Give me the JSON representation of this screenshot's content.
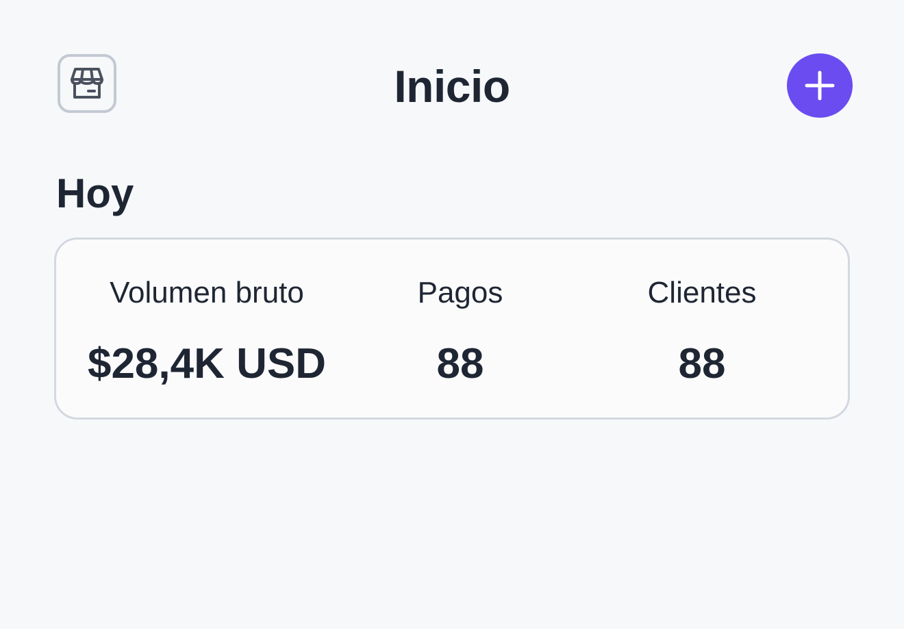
{
  "header": {
    "title": "Inicio",
    "store_icon": "storefront-icon",
    "add_icon": "plus-icon"
  },
  "today": {
    "heading": "Hoy",
    "metrics": [
      {
        "label": "Volumen bruto",
        "value": "$28,4K USD"
      },
      {
        "label": "Pagos",
        "value": "88"
      },
      {
        "label": "Clientes",
        "value": "88"
      }
    ]
  },
  "colors": {
    "accent": "#6a4cf0",
    "text": "#1f2633",
    "border": "#d3d8e0",
    "background": "#f7f8fa"
  }
}
